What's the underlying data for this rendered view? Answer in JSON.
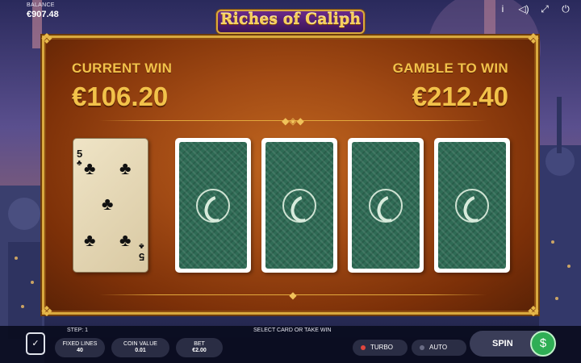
{
  "game": {
    "title": "Riches of Caliph"
  },
  "balance": {
    "label": "BALANCE",
    "value": "€907.48"
  },
  "top_icons": [
    {
      "name": "info-icon",
      "glyph": "i"
    },
    {
      "name": "sound-icon",
      "glyph": "◁)"
    },
    {
      "name": "fullscreen-icon",
      "glyph": "⤢"
    },
    {
      "name": "power-icon",
      "glyph": "⏻"
    }
  ],
  "gamble": {
    "current_win_label": "CURRENT WIN",
    "current_win_value": "€106.20",
    "gamble_to_win_label": "GAMBLE TO WIN",
    "gamble_to_win_value": "€212.40"
  },
  "cards": [
    {
      "state": "face-up",
      "rank": "5",
      "suit": "clubs",
      "suit_glyph": "♣"
    },
    {
      "state": "face-down"
    },
    {
      "state": "face-down"
    },
    {
      "state": "face-down"
    },
    {
      "state": "face-down"
    }
  ],
  "bottom": {
    "step": "STEP: 1",
    "message": "SELECT CARD OR TAKE WIN",
    "fixed_lines": {
      "label": "FIXED LINES",
      "value": "40"
    },
    "coin_value": {
      "label": "COIN VALUE",
      "value": "0.01"
    },
    "bet": {
      "label": "BET",
      "value": "€2.00"
    },
    "turbo_label": "TURBO",
    "auto_label": "AUTO",
    "spin_label": "SPIN",
    "ticket_glyph": "✓",
    "cash_glyph": "$"
  },
  "colors": {
    "gold": "#f2c24a",
    "panel": "#a14a14",
    "card_back": "#2f6b55",
    "turbo_dot": "#e0463e",
    "spin_green": "#2fae55"
  }
}
